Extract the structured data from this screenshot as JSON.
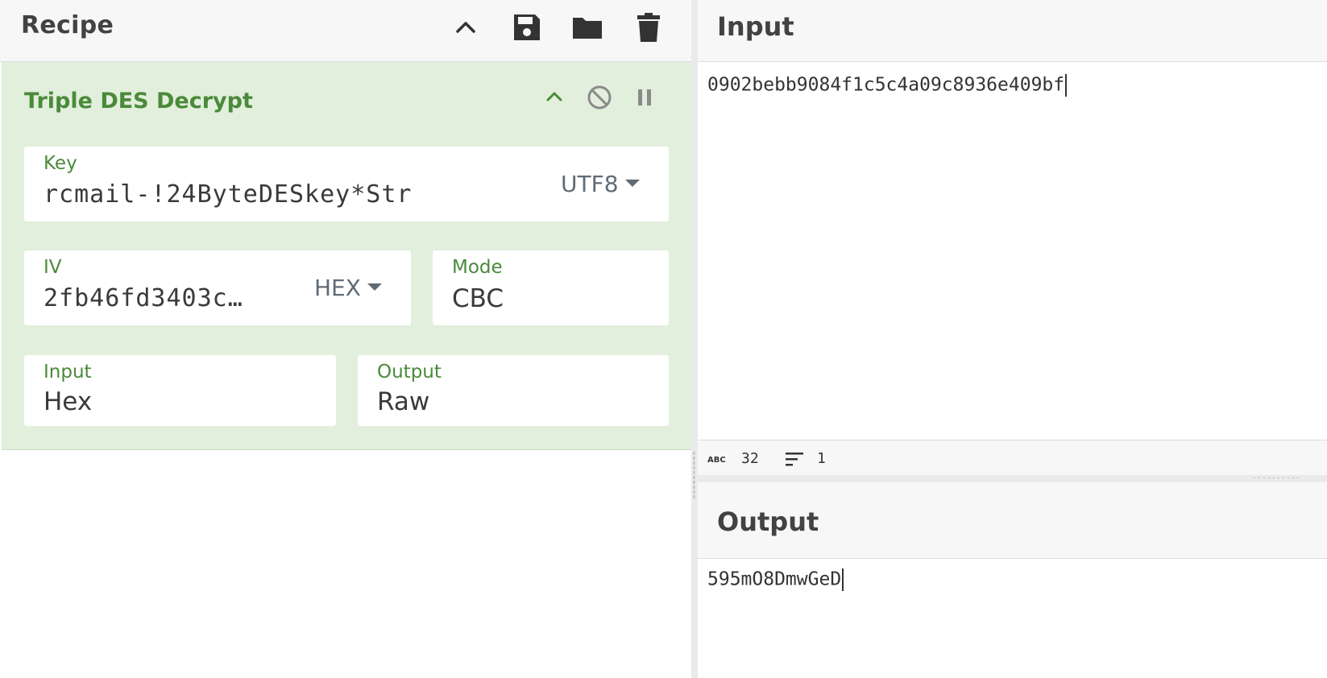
{
  "recipe": {
    "title": "Recipe",
    "operation": {
      "title": "Triple DES Decrypt",
      "key": {
        "label": "Key",
        "value": "rcmail-!24ByteDESkey*Str",
        "encoding": "UTF8"
      },
      "iv": {
        "label": "IV",
        "value": "2fb46fd3403c…",
        "encoding": "HEX"
      },
      "mode": {
        "label": "Mode",
        "value": "CBC"
      },
      "input": {
        "label": "Input",
        "value": "Hex"
      },
      "output": {
        "label": "Output",
        "value": "Raw"
      }
    }
  },
  "input_pane": {
    "title": "Input",
    "text": "0902bebb9084f1c5c4a09c8936e409bf",
    "status": {
      "length": "32",
      "lines": "1",
      "length_icon": "abc-icon",
      "lines_icon": "lines-icon"
    }
  },
  "output_pane": {
    "title": "Output",
    "text": "595mO8DmwGeD"
  },
  "colors": {
    "operation_bg": "#e1efdc",
    "operation_accent": "#4a8a3a",
    "header_bg": "#f7f7f7"
  },
  "icons": {
    "header": [
      "chevron-up-icon",
      "save-icon",
      "folder-icon",
      "trash-icon"
    ],
    "operation": [
      "chevron-up-icon",
      "disable-icon",
      "pause-icon"
    ]
  }
}
